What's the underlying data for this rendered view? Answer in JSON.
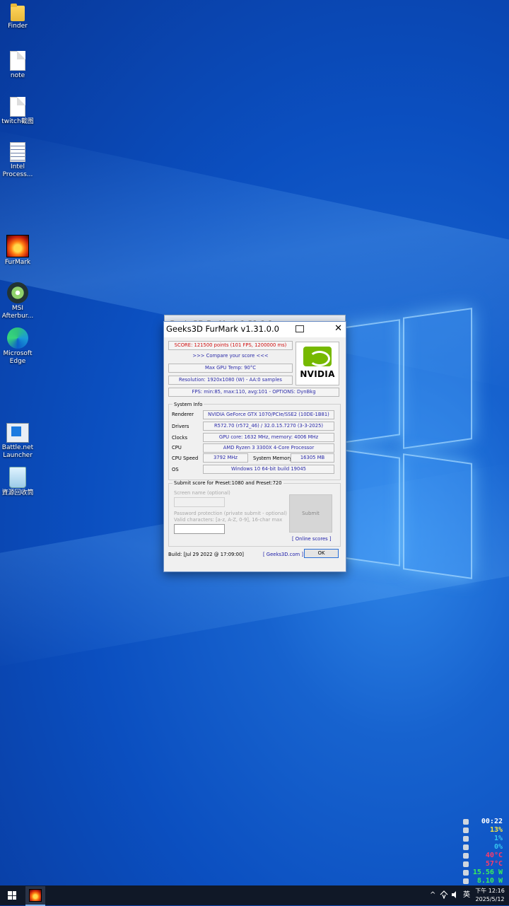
{
  "desktop": {
    "icons": [
      {
        "label": "Finder",
        "icon": "folder-icon"
      },
      {
        "label": "note",
        "icon": "document-icon"
      },
      {
        "label": "twitch截图",
        "icon": "document-icon"
      },
      {
        "label": "Intel Process...",
        "icon": "shortcut-document-icon"
      },
      {
        "label": "FurMark",
        "icon": "furmark-icon"
      },
      {
        "label": "MSI Afterbur...",
        "icon": "msi-afterburner-icon"
      },
      {
        "label": "Microsoft Edge",
        "icon": "edge-icon"
      },
      {
        "label": "Battle.net Launcher",
        "icon": "battlenet-icon"
      },
      {
        "label": "資源回收筒",
        "icon": "recycle-bin-icon"
      }
    ]
  },
  "ghost_window": {
    "title": "Geeks3D FurMark 1.31.0.0"
  },
  "window": {
    "title": "Geeks3D FurMark v1.31.0.0",
    "close": "✕",
    "score": "SCORE: 121500 points (101 FPS, 1200000 ms)",
    "compare": ">>> Compare your score <<<",
    "max_gpu_temp": "Max GPU Temp: 90°C",
    "resolution": "Resolution: 1920x1080 (W) - AA:0 samples",
    "fps": "FPS: min:85, max:110, avg:101 - OPTIONS: DynBkg",
    "nvidia_logo": "NVIDIA",
    "system_info": {
      "title": "System Info",
      "renderer_label": "Renderer",
      "renderer": "NVIDIA GeForce GTX 1070/PCIe/SSE2 (10DE-1B81)",
      "drivers_label": "Drivers",
      "drivers": "R572.70 (r572_46) / 32.0.15.7270 (3-3-2025)",
      "clocks_label": "Clocks",
      "clocks": "GPU core: 1632 MHz, memory: 4006 MHz",
      "cpu_label": "CPU",
      "cpu": "AMD Ryzen 3 3300X 4-Core Processor",
      "cpu_speed_label": "CPU Speed",
      "cpu_speed": "3792 MHz",
      "system_memory_label": "System Memory",
      "system_memory": "16305 MB",
      "os_label": "OS",
      "os": "Windows 10 64-bit build 19045"
    },
    "submit": {
      "title": "Submit score for Preset:1080 and Preset:720",
      "screen_name_label": "Screen name (optional)",
      "password_label": "Password protection (private submit - optional)",
      "valid_chars": "Valid characters: [a-z, A-Z, 0-9], 16-char max",
      "submit_button": "Submit",
      "online_scores": "[ Online scores ]"
    },
    "build": "Build: [Jul 29 2022 @ 17:09:00]",
    "geeks3d_link": "[ Geeks3D.com ]",
    "ok": "OK"
  },
  "sensors": [
    {
      "value": "00:22",
      "color": "#ffffff"
    },
    {
      "value": "13%",
      "color": "#f5e642"
    },
    {
      "value": "1%",
      "color": "#36c4f0"
    },
    {
      "value": "0%",
      "color": "#36c4f0"
    },
    {
      "value": "40°C",
      "color": "#ff3a6a"
    },
    {
      "value": "57°C",
      "color": "#ff3a6a"
    },
    {
      "value": "15.56 W",
      "color": "#3af05a"
    },
    {
      "value": "8.10 W",
      "color": "#3af05a"
    }
  ],
  "taskbar": {
    "tray_chevron": "^",
    "ime": "英",
    "time": "下午 12:16",
    "date": "2025/5/12"
  }
}
